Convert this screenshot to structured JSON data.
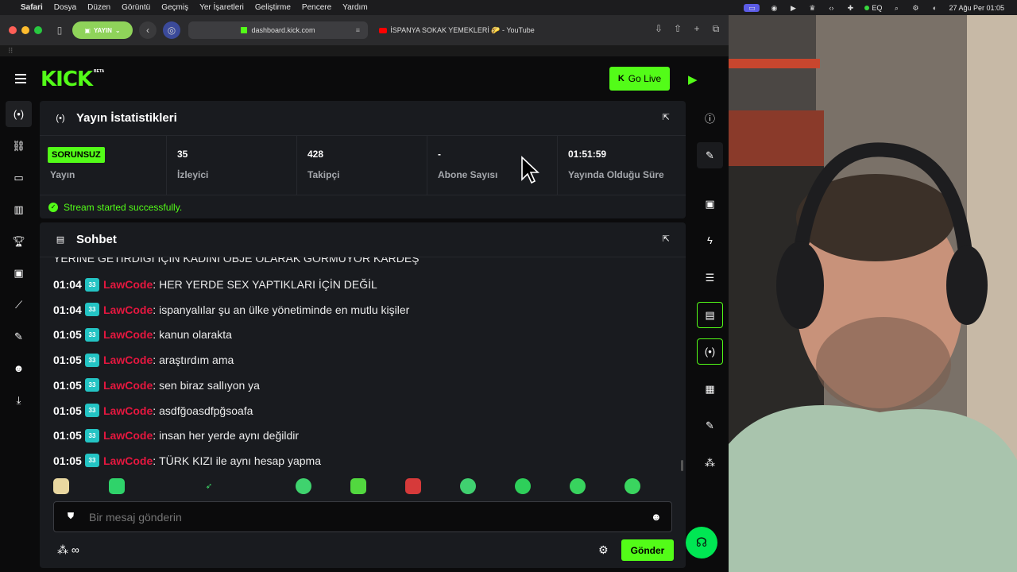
{
  "menubar": {
    "apple": "",
    "items": [
      "Safari",
      "Dosya",
      "Düzen",
      "Görüntü",
      "Geçmiş",
      "Yer İşaretleri",
      "Geliştirme",
      "Pencere",
      "Yardım"
    ],
    "eq_label": "EQ",
    "datetime": "27 Ağu Per  01:05"
  },
  "safari": {
    "profile_label": "YAYIN",
    "active_tab_url": "dashboard.kick.com",
    "other_tab_title": "İSPANYA SOKAK YEMEKLERİ 🌮 - YouTube"
  },
  "kick": {
    "logo": "KICK",
    "beta": "BETA",
    "go_live": "Go Live"
  },
  "stats_panel": {
    "title": "Yayın İstatistikleri",
    "status_badge": "SORUNSUZ",
    "status_label": "Yayın",
    "viewers_value": "35",
    "viewers_label": "İzleyici",
    "followers_value": "428",
    "followers_label": "Takipçi",
    "subs_value": "-",
    "subs_label": "Abone Sayısı",
    "uptime_value": "01:51:59",
    "uptime_label": "Yayında Olduğu Süre",
    "stream_message": "Stream started successfully."
  },
  "chat_panel": {
    "title": "Sohbet",
    "cut_line": "YERİNE GETİRDİĞİ İÇİN KADINI OBJE OLARAK GÖRMÜYOR KARDEŞ",
    "messages": [
      {
        "time": "01:04",
        "badge": "33",
        "user": "LawCode",
        "text": "HER YERDE SEX YAPTIKLARI İÇİN DEĞİL"
      },
      {
        "time": "01:04",
        "badge": "33",
        "user": "LawCode",
        "text": "ispanyalılar şu an ülke yönetiminde en mutlu kişiler"
      },
      {
        "time": "01:05",
        "badge": "33",
        "user": "LawCode",
        "text": "kanun olarakta"
      },
      {
        "time": "01:05",
        "badge": "33",
        "user": "LawCode",
        "text": "araştırdım ama"
      },
      {
        "time": "01:05",
        "badge": "33",
        "user": "LawCode",
        "text": "sen biraz sallıyon ya"
      },
      {
        "time": "01:05",
        "badge": "33",
        "user": "LawCode",
        "text": "asdfğoasdfpğsoafa"
      },
      {
        "time": "01:05",
        "badge": "33",
        "user": "LawCode",
        "text": "insan her yerde aynı değildir"
      },
      {
        "time": "01:05",
        "badge": "33",
        "user": "LawCode",
        "text": "TÜRK KIZI ile aynı hesap yapma"
      }
    ],
    "input_placeholder": "Bir mesaj gönderin",
    "send_label": "Gönder",
    "infinity_symbol": "∞"
  },
  "colors": {
    "kick_green": "#53fc18",
    "username_red": "#e5173f",
    "sub_badge": "#24c4c4",
    "panel_bg": "#191b1f",
    "page_bg": "#0b0b0c"
  }
}
